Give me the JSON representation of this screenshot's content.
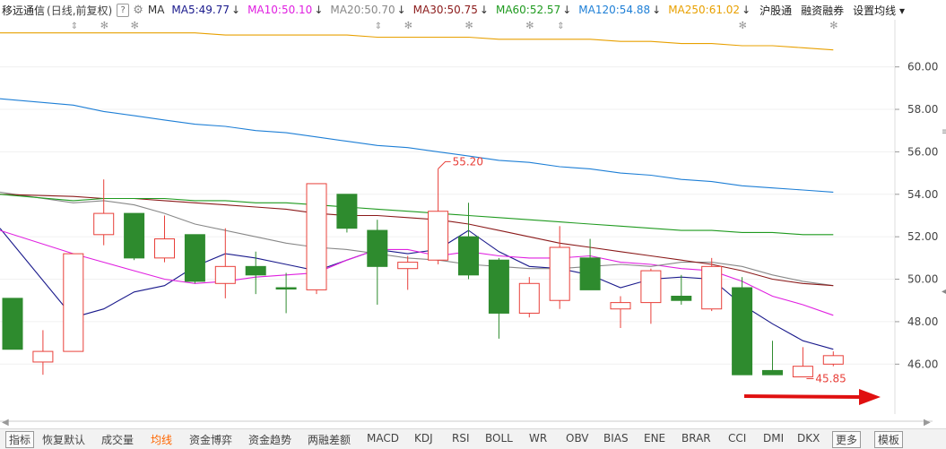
{
  "header": {
    "stock_name": "移远通信",
    "mode": "(日线,前复权)",
    "help": "?",
    "ma_label": "MA",
    "ma": [
      {
        "label": "MA5:49.77",
        "arrow": "↓",
        "color": "#1a1a8c"
      },
      {
        "label": "MA10:50.10",
        "arrow": "↓",
        "color": "#e020e0"
      },
      {
        "label": "MA20:50.70",
        "arrow": "↓",
        "color": "#888888"
      },
      {
        "label": "MA30:50.75",
        "arrow": "↓",
        "color": "#8b1a1a"
      },
      {
        "label": "MA60:52.57",
        "arrow": "↓",
        "color": "#1f9a1f"
      },
      {
        "label": "MA120:54.88",
        "arrow": "↓",
        "color": "#1e7fd6"
      },
      {
        "label": "MA250:61.02",
        "arrow": "↓",
        "color": "#e8a000"
      }
    ],
    "menu": [
      "沪股通",
      "融资融券",
      "设置均线 ▾"
    ]
  },
  "y_axis": {
    "ticks": [
      "60.00",
      "58.00",
      "56.00",
      "54.00",
      "52.00",
      "50.00",
      "48.00",
      "46.00"
    ]
  },
  "annotations": {
    "high": "55.20",
    "low": "45.85"
  },
  "bottom_tabs": [
    "指标",
    "恢复默认",
    "成交量",
    "均线",
    "资金博弈",
    "资金趋势",
    "两融差额",
    "MACD",
    "KDJ",
    "RSI",
    "BOLL",
    "WR",
    "OBV",
    "BIAS",
    "ENE",
    "BRAR",
    "CCI",
    "DMI",
    "DKX",
    "更多",
    "模板"
  ],
  "active_tab": "均线",
  "colors": {
    "up": "#e8403a",
    "down": "#2e8b2e",
    "arrow": "#e01010"
  },
  "chart_data": {
    "type": "candlestick",
    "ylim": [
      45,
      61.8
    ],
    "candles": [
      {
        "open": 49.1,
        "high": 49.1,
        "low": 46.7,
        "close": 46.7
      },
      {
        "open": 46.1,
        "high": 47.6,
        "low": 45.5,
        "close": 46.6
      },
      {
        "open": 46.6,
        "high": 51.2,
        "low": 46.6,
        "close": 51.2
      },
      {
        "open": 52.1,
        "high": 54.7,
        "low": 51.6,
        "close": 53.1
      },
      {
        "open": 53.1,
        "high": 53.1,
        "low": 50.9,
        "close": 51.0
      },
      {
        "open": 51.0,
        "high": 53.0,
        "low": 50.8,
        "close": 51.9
      },
      {
        "open": 52.1,
        "high": 52.1,
        "low": 49.8,
        "close": 49.9
      },
      {
        "open": 49.8,
        "high": 52.4,
        "low": 49.1,
        "close": 50.6
      },
      {
        "open": 50.6,
        "high": 51.3,
        "low": 49.3,
        "close": 50.2
      },
      {
        "open": 49.6,
        "high": 50.3,
        "low": 48.4,
        "close": 49.6
      },
      {
        "open": 49.5,
        "high": 54.5,
        "low": 49.3,
        "close": 54.5
      },
      {
        "open": 54.0,
        "high": 54.0,
        "low": 52.2,
        "close": 52.4
      },
      {
        "open": 52.3,
        "high": 52.8,
        "low": 48.8,
        "close": 50.6
      },
      {
        "open": 50.5,
        "high": 51.1,
        "low": 49.5,
        "close": 50.8
      },
      {
        "open": 50.9,
        "high": 55.2,
        "low": 50.7,
        "close": 53.2
      },
      {
        "open": 52.0,
        "high": 53.6,
        "low": 50.0,
        "close": 50.2
      },
      {
        "open": 50.9,
        "high": 51.0,
        "low": 47.2,
        "close": 48.4
      },
      {
        "open": 48.4,
        "high": 50.1,
        "low": 48.2,
        "close": 49.8
      },
      {
        "open": 49.0,
        "high": 52.5,
        "low": 48.6,
        "close": 51.5
      },
      {
        "open": 51.0,
        "high": 51.9,
        "low": 49.5,
        "close": 49.5
      },
      {
        "open": 48.6,
        "high": 49.2,
        "low": 47.7,
        "close": 48.9
      },
      {
        "open": 48.9,
        "high": 50.5,
        "low": 47.9,
        "close": 50.4
      },
      {
        "open": 49.2,
        "high": 50.2,
        "low": 48.8,
        "close": 49.0
      },
      {
        "open": 48.6,
        "high": 51.0,
        "low": 48.5,
        "close": 50.6
      },
      {
        "open": 49.6,
        "high": 50.1,
        "low": 45.5,
        "close": 45.5
      },
      {
        "open": 45.7,
        "high": 47.1,
        "low": 45.5,
        "close": 45.5
      },
      {
        "open": 45.4,
        "high": 46.8,
        "low": 45.4,
        "close": 45.9
      },
      {
        "open": 46.0,
        "high": 46.6,
        "low": 45.9,
        "close": 46.4
      }
    ],
    "ma_series": [
      {
        "name": "MA5",
        "color": "#1a1a8c",
        "values": [
          52.4,
          null,
          48.2,
          48.6,
          49.4,
          49.7,
          50.6,
          51.2,
          51.0,
          50.7,
          50.4,
          50.9,
          51.4,
          51.2,
          51.4,
          52.3,
          51.3,
          50.6,
          50.5,
          50.2,
          49.6,
          50.0,
          50.1,
          50.0,
          48.8,
          47.9,
          47.1,
          46.7
        ]
      },
      {
        "name": "MA10",
        "color": "#e020e0",
        "values": [
          52.3,
          null,
          51.2,
          50.8,
          50.4,
          50.0,
          49.8,
          49.9,
          50.1,
          50.2,
          50.3,
          50.9,
          51.4,
          51.4,
          51.1,
          51.3,
          51.1,
          51.0,
          51.0,
          51.1,
          50.8,
          50.7,
          50.5,
          50.4,
          49.9,
          49.2,
          48.8,
          48.3
        ]
      },
      {
        "name": "MA20",
        "color": "#888888",
        "values": [
          54.1,
          null,
          53.6,
          53.7,
          53.5,
          53.1,
          52.6,
          52.3,
          52.0,
          51.7,
          51.5,
          51.4,
          51.2,
          51.0,
          50.9,
          50.7,
          50.6,
          50.5,
          50.5,
          50.6,
          50.7,
          50.6,
          50.8,
          50.8,
          50.6,
          50.2,
          49.9,
          49.7
        ]
      },
      {
        "name": "MA30",
        "color": "#8b1a1a",
        "values": [
          54.0,
          null,
          53.9,
          53.8,
          53.8,
          53.7,
          53.6,
          53.5,
          53.4,
          53.3,
          53.1,
          53.0,
          53.0,
          52.9,
          52.8,
          52.6,
          52.3,
          52.0,
          51.7,
          51.5,
          51.3,
          51.1,
          50.9,
          50.7,
          50.4,
          50.0,
          49.8,
          49.7
        ]
      },
      {
        "name": "MA60",
        "color": "#1f9a1f",
        "values": [
          54.0,
          null,
          53.7,
          53.8,
          53.8,
          53.8,
          53.7,
          53.7,
          53.6,
          53.6,
          53.5,
          53.4,
          53.3,
          53.2,
          53.1,
          53.0,
          52.9,
          52.8,
          52.7,
          52.6,
          52.5,
          52.4,
          52.3,
          52.3,
          52.2,
          52.2,
          52.1,
          52.1
        ]
      },
      {
        "name": "MA120",
        "color": "#1e7fd6",
        "values": [
          58.5,
          null,
          58.2,
          57.9,
          57.7,
          57.5,
          57.3,
          57.2,
          57.0,
          56.9,
          56.7,
          56.5,
          56.3,
          56.2,
          56.0,
          55.8,
          55.6,
          55.5,
          55.3,
          55.2,
          55.0,
          54.9,
          54.7,
          54.6,
          54.4,
          54.3,
          54.2,
          54.1
        ]
      },
      {
        "name": "MA250",
        "color": "#e8a000",
        "values": [
          61.6,
          null,
          61.6,
          61.6,
          61.6,
          61.6,
          61.6,
          61.5,
          61.5,
          61.5,
          61.5,
          61.5,
          61.4,
          61.4,
          61.4,
          61.4,
          61.3,
          61.3,
          61.3,
          61.3,
          61.2,
          61.2,
          61.1,
          61.1,
          61.0,
          61.0,
          60.9,
          60.8
        ]
      }
    ],
    "markers_star": [
      3,
      4,
      13,
      15,
      17,
      24,
      27
    ],
    "markers_arrow": [
      2,
      12,
      18
    ]
  }
}
